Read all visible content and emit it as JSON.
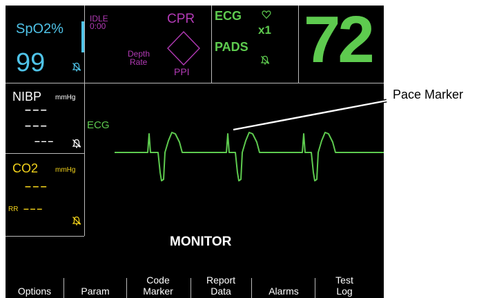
{
  "spo2": {
    "label": "SpO2%",
    "value": "99",
    "bell_icon": "alarm-off-bell-icon",
    "color": "#4fc3e8"
  },
  "cpr": {
    "status_line1": "IDLE",
    "status_line2": "0:00",
    "title": "CPR",
    "depth": "Depth",
    "rate": "Rate",
    "ppi": "PPI",
    "color": "#b23ab5"
  },
  "ecg_box": {
    "lead": "ECG",
    "gain": "x1",
    "source": "PADS",
    "heart_icon": "heart-icon",
    "bell_icon": "alarm-off-bell-icon"
  },
  "heart_rate": {
    "value": "72",
    "color": "#5ecb4f"
  },
  "nibp": {
    "label": "NIBP",
    "unit": "mmHg",
    "systolic": "– – –",
    "diastolic": "– – –",
    "map": "– – –",
    "bell_icon": "alarm-off-bell-icon"
  },
  "co2": {
    "label": "CO2",
    "unit": "mmHg",
    "value": "– – –",
    "rr_label": "RR",
    "rr_value": "– – –",
    "bell_icon": "alarm-off-bell-icon",
    "color": "#f2d21b"
  },
  "waveform": {
    "label": "ECG",
    "color": "#5ecb4f"
  },
  "mode": "MONITOR",
  "softkeys": [
    {
      "line1": "",
      "line2": "Options"
    },
    {
      "line1": "",
      "line2": "Param"
    },
    {
      "line1": "Code",
      "line2": "Marker"
    },
    {
      "line1": "Report",
      "line2": "Data"
    },
    {
      "line1": "",
      "line2": "Alarms"
    },
    {
      "line1": "Test",
      "line2": "Log"
    }
  ],
  "callout": {
    "label": "Pace Marker"
  }
}
